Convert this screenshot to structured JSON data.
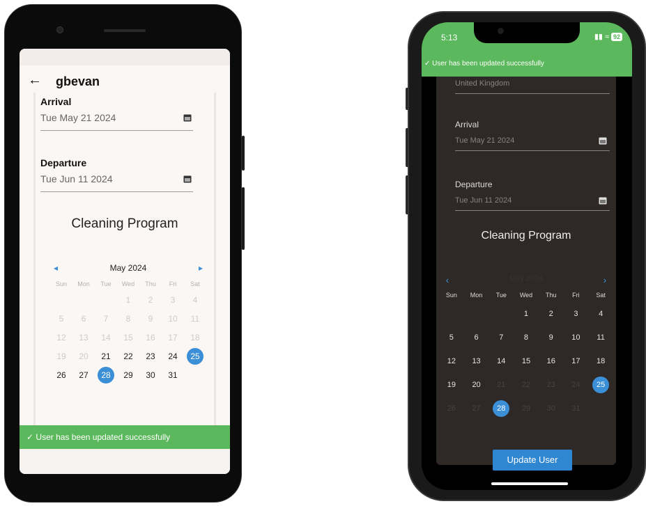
{
  "android": {
    "username": "gbevan",
    "arrival_label": "Arrival",
    "arrival_value": "Tue May 21 2024",
    "departure_label": "Departure",
    "departure_value": "Tue Jun 11 2024",
    "section_title": "Cleaning Program",
    "calendar": {
      "month": "May 2024",
      "weekdays": [
        "Sun",
        "Mon",
        "Tue",
        "Wed",
        "Thu",
        "Fri",
        "Sat"
      ],
      "leading_blanks": 3,
      "days_in_month": 31,
      "enabled_from": 21,
      "selected": [
        25,
        28
      ]
    },
    "snackbar": "User has been updated successfully"
  },
  "ios": {
    "status_time": "5:13",
    "battery": "92",
    "snackbar": "User has been updated successfully",
    "country_value": "United Kingdom",
    "arrival_label": "Arrival",
    "arrival_value": "Tue May 21 2024",
    "departure_label": "Departure",
    "departure_value": "Tue Jun 11 2024",
    "section_title": "Cleaning Program",
    "calendar": {
      "month": "May 2024",
      "weekdays": [
        "Sun",
        "Mon",
        "Tue",
        "Wed",
        "Thu",
        "Fri",
        "Sat"
      ],
      "leading_blanks": 3,
      "days_in_month": 31,
      "enabled_range": [
        1,
        20
      ],
      "selected": [
        25,
        28
      ]
    },
    "update_button": "Update User"
  },
  "colors": {
    "accent": "#3a8fd6",
    "success": "#5cb85c",
    "dark_card": "#2e2826"
  }
}
